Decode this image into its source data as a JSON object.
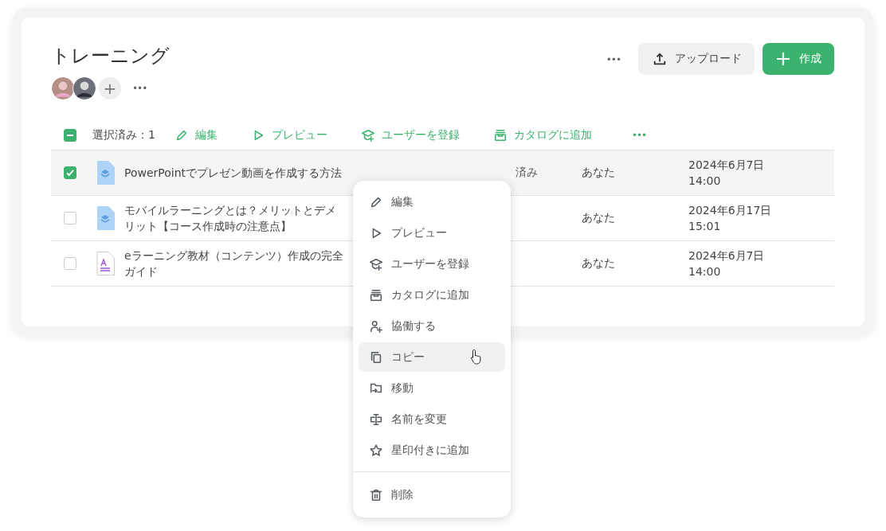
{
  "header": {
    "title": "トレーニング",
    "more_button": "•••",
    "upload_button": "アップロード",
    "create_button": "作成"
  },
  "members": {
    "add_button": "+",
    "more_button": "•••"
  },
  "selection_bar": {
    "indeterminate": true,
    "count_label": "選択済み：1",
    "actions": [
      {
        "kind": "edit",
        "label": "編集"
      },
      {
        "kind": "preview",
        "label": "プレビュー"
      },
      {
        "kind": "enroll",
        "label": "ユーザーを登録"
      },
      {
        "kind": "catalog",
        "label": "カタログに追加"
      }
    ],
    "more_button": "•••"
  },
  "table": {
    "rows": [
      {
        "checked": true,
        "kind": "course",
        "title": "PowerPointでプレゼン動画を作成する方法",
        "column_4": "済み",
        "owner": "あなた",
        "date": "2024年6月7日",
        "time": "14:00"
      },
      {
        "checked": false,
        "kind": "course",
        "title": "モバイルラーニングとは？メリットとデメリット【コース作成時の注意点】",
        "owner": "あなた",
        "date": "2024年6月17日",
        "time": "15:01"
      },
      {
        "checked": false,
        "kind": "document",
        "title": "eラーニング教材（コンテンツ）作成の完全ガイド",
        "owner": "あなた",
        "date": "2024年6月7日",
        "time": "14:00"
      }
    ]
  },
  "context_menu": {
    "groups": [
      [
        {
          "kind": "edit",
          "label": "編集",
          "hovered": false
        },
        {
          "kind": "preview",
          "label": "プレビュー",
          "hovered": false
        },
        {
          "kind": "enroll",
          "label": "ユーザーを登録",
          "hovered": false
        },
        {
          "kind": "catalog",
          "label": "カタログに追加",
          "hovered": false
        },
        {
          "kind": "collaborate",
          "label": "協働する",
          "hovered": false
        },
        {
          "kind": "copy",
          "label": "コピー",
          "hovered": true
        },
        {
          "kind": "move",
          "label": "移動",
          "hovered": false
        },
        {
          "kind": "rename",
          "label": "名前を変更",
          "hovered": false
        },
        {
          "kind": "star",
          "label": "星印付きに追加",
          "hovered": false
        }
      ],
      [
        {
          "kind": "delete",
          "label": "削除",
          "hovered": false
        }
      ]
    ]
  }
}
